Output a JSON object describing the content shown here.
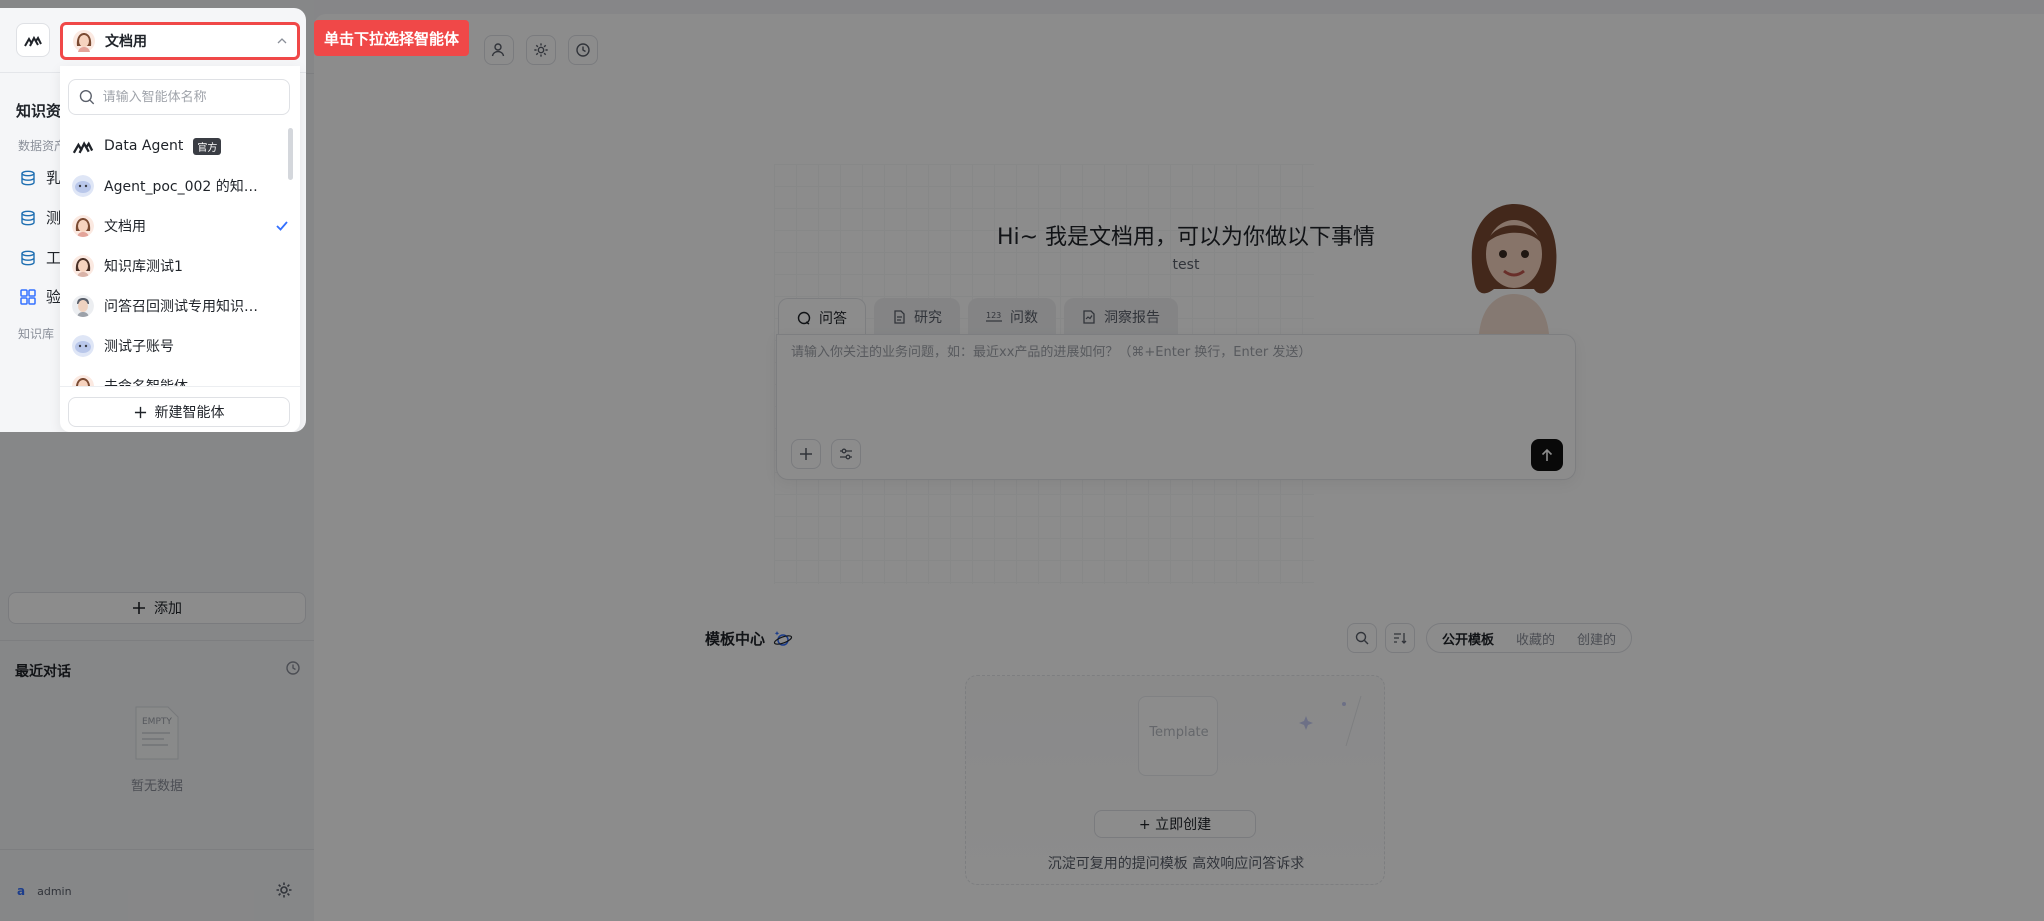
{
  "selector": {
    "selected": "文档用"
  },
  "callout": {
    "text": "单击下拉选择智能体"
  },
  "dropdown": {
    "search_placeholder": "请输入智能体名称",
    "items": [
      {
        "name": "Data Agent",
        "badge": "官方",
        "avatar": "data-agent-logo"
      },
      {
        "name": "Agent_poc_002 的知识…",
        "avatar": "blob-avatar"
      },
      {
        "name": "文档用",
        "selected": true,
        "avatar": "woman-avatar"
      },
      {
        "name": "知识库测试1",
        "avatar": "woman-avatar"
      },
      {
        "name": "问答召回测试专用知识…",
        "avatar": "man-avatar"
      },
      {
        "name": "测试子账号",
        "avatar": "blob-avatar"
      },
      {
        "name": "未命名智能体",
        "avatar": "woman-avatar"
      }
    ],
    "new_button": "新建智能体"
  },
  "sidebar": {
    "section_title": "知识资产",
    "data_assets_label": "数据资产",
    "items": [
      {
        "label": "乳",
        "icon": "database-icon"
      },
      {
        "label": "测",
        "icon": "database-icon"
      },
      {
        "label": "工",
        "icon": "database-icon"
      },
      {
        "label": "验",
        "icon": "grid-icon"
      }
    ],
    "knowledge_label": "知识库",
    "add_button": "添加",
    "recent_title": "最近对话",
    "empty_text": "暂无数据",
    "empty_doc_label": "EMPTY",
    "user_initial": "a",
    "user_name": "admin"
  },
  "main": {
    "greeting": "Hi~ 我是文档用，可以为你做以下事情",
    "subtitle": "test",
    "tabs": [
      {
        "label": "问答",
        "active": true
      },
      {
        "label": "研究"
      },
      {
        "label": "问数"
      },
      {
        "label": "洞察报告"
      }
    ],
    "input_placeholder": "请输入你关注的业务问题，如：最近xx产品的进展如何？（⌘+Enter 换行，Enter 发送）",
    "template": {
      "title": "模板中心",
      "filters": [
        "公开模板",
        "收藏的",
        "创建的"
      ],
      "ghost_label": "Template",
      "create_button": "+ 立即创建",
      "description": "沉淀可复用的提问模板 高效响应问答诉求"
    }
  },
  "colors": {
    "highlight": "#f04848",
    "accent": "#3370ff",
    "send": "#111111"
  }
}
